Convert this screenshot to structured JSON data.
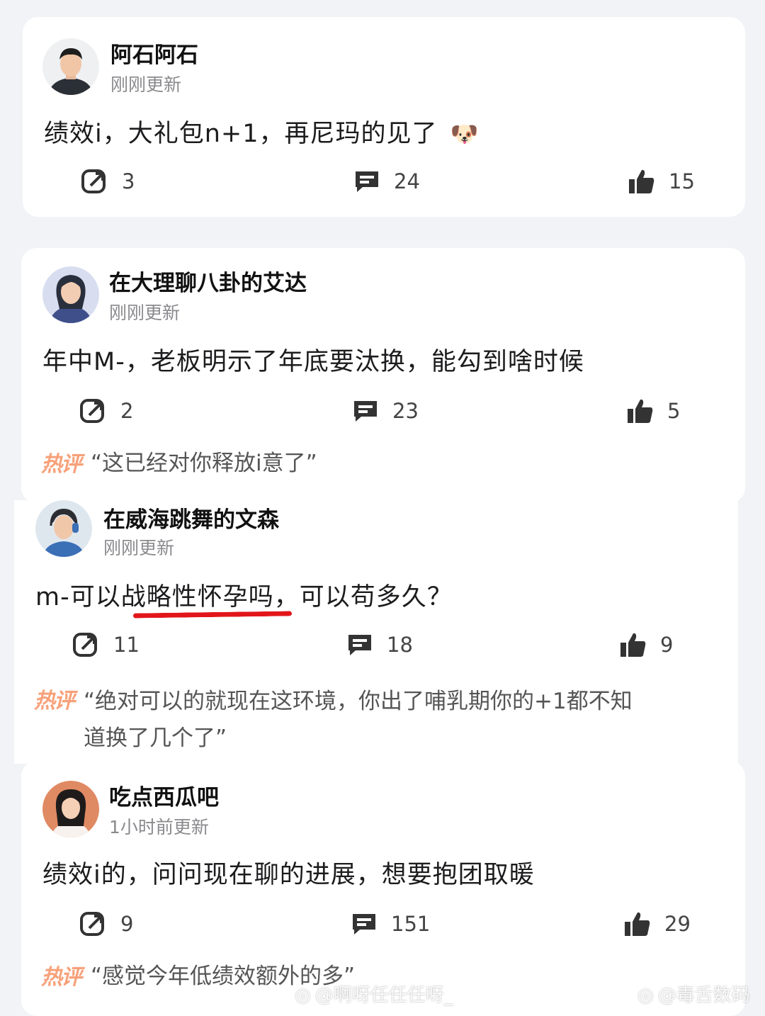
{
  "posts": [
    {
      "username": "阿石阿石",
      "time": "刚刚更新",
      "content": "绩效i，大礼包n+1，再尼玛的见了",
      "emoji": "🐶",
      "share_count": "3",
      "comment_count": "24",
      "like_count": "15"
    },
    {
      "username": "在大理聊八卦的艾达",
      "time": "刚刚更新",
      "content": "年中M-，老板明示了年底要汰换，能勾到啥时候",
      "share_count": "2",
      "comment_count": "23",
      "like_count": "5",
      "hot_label": "热评",
      "hot_comment": "“这已经对你释放i意了”"
    },
    {
      "username": "在威海跳舞的文森",
      "time": "刚刚更新",
      "content": "m-可以战略性怀孕吗，可以苟多久？",
      "share_count": "11",
      "comment_count": "18",
      "like_count": "9",
      "hot_label": "热评",
      "hot_comment_line1": "“绝对可以的就现在这环境，你出了哺乳期你的+1都不知",
      "hot_comment_line2": "道换了几个了”"
    },
    {
      "username": "吃点西瓜吧",
      "time": "1小时前更新",
      "content": "绩效i的，问问现在聊的进展，想要抱团取暖",
      "share_count": "9",
      "comment_count": "151",
      "like_count": "29",
      "hot_label": "热评",
      "hot_comment": "“感觉今年低绩效额外的多”"
    }
  ],
  "watermarks": {
    "left": "@啊呀任任任呀_",
    "right": "@毒舌数码"
  },
  "colors": {
    "background": "#f1f3f6",
    "card": "#ffffff",
    "hot_tag": "#f7a17a",
    "underline": "#e2161a"
  }
}
